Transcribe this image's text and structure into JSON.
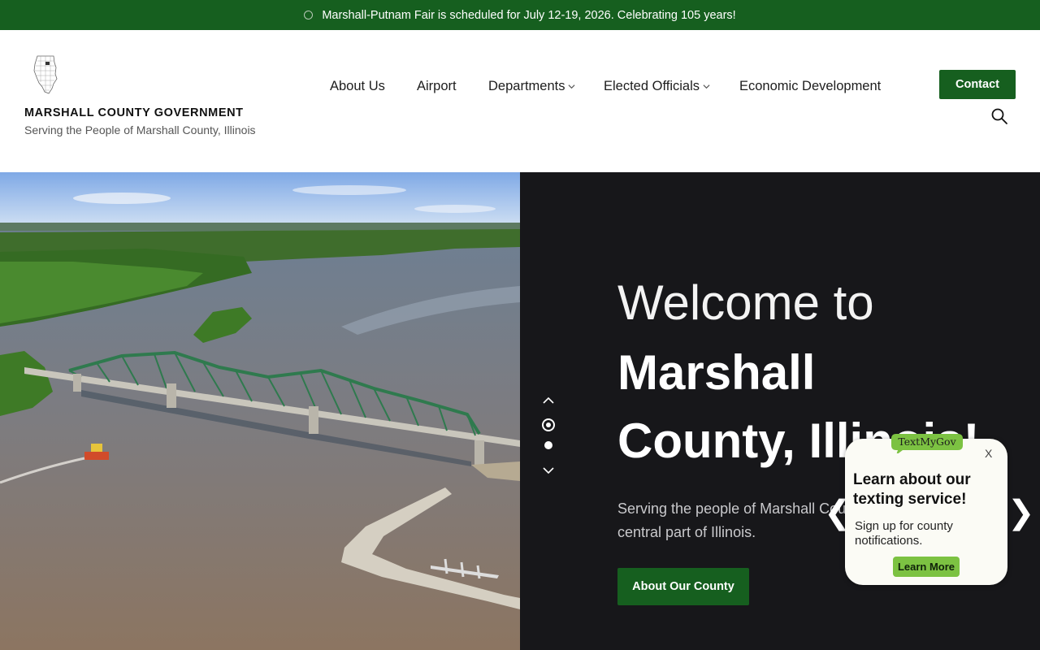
{
  "colors": {
    "brand_green": "#165f1f",
    "hero_panel_bg": "#17171a",
    "tmg_green": "#7cc242"
  },
  "announcement": {
    "icon": "circle-outline-icon",
    "text": "Marshall-Putnam Fair is scheduled for July 12-19, 2026. Celebrating 105 years!"
  },
  "header": {
    "logo_icon": "illinois-county-map-icon",
    "org_name": "MARSHALL COUNTY GOVERNMENT",
    "tagline": "Serving the People of Marshall County, Illinois",
    "nav": [
      {
        "label": "About Us",
        "has_dropdown": false
      },
      {
        "label": "Airport",
        "has_dropdown": false
      },
      {
        "label": "Departments",
        "has_dropdown": true
      },
      {
        "label": "Elected Officials",
        "has_dropdown": true
      },
      {
        "label": "Economic Development",
        "has_dropdown": false
      }
    ],
    "contact_label": "Contact",
    "search_icon": "search-icon"
  },
  "hero": {
    "image": "aerial-river-bridge-photo",
    "heading_line1": "Welcome to",
    "heading_line2": "Marshall",
    "heading_line3": "County, Illinois!",
    "subtitle": "Serving the people of Marshall County, located in the north central part of Illinois.",
    "button_label": "About Our County",
    "slide_up_icon": "chevron-up-icon",
    "slide_down_icon": "chevron-down-icon",
    "prev_arrow": "❮",
    "next_arrow": "❯"
  },
  "textmygov": {
    "badge": "TextMyGov",
    "close": "X",
    "title": "Learn about our texting service!",
    "body": "Sign up for county notifications.",
    "button": "Learn More"
  }
}
